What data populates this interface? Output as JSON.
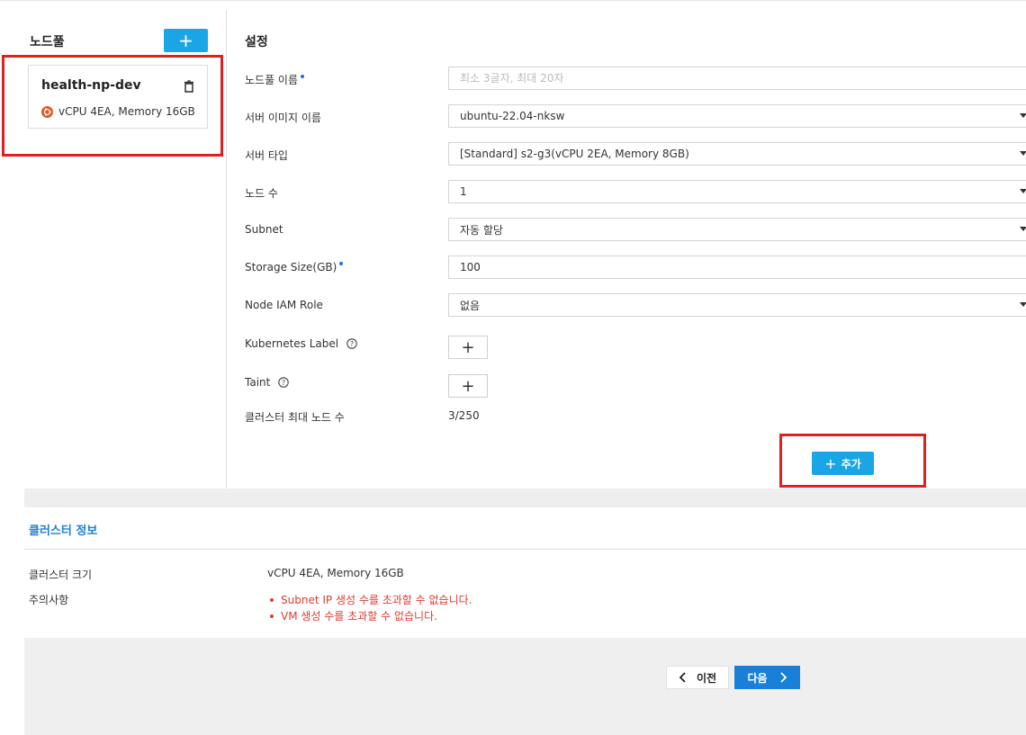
{
  "left": {
    "title": "노드풀",
    "add_button": "+",
    "pool": {
      "name": "health-np-dev",
      "spec": "vCPU 4EA, Memory 16GB"
    }
  },
  "settings": {
    "title": "설정",
    "rows": {
      "name": {
        "label": "노드풀 이름",
        "placeholder": "최소 3글자, 최대 20자"
      },
      "image": {
        "label": "서버 이미지 이름",
        "value": "ubuntu-22.04-nksw"
      },
      "type": {
        "label": "서버 타입",
        "value": "[Standard] s2-g3(vCPU 2EA, Memory 8GB)"
      },
      "count": {
        "label": "노드 수",
        "value": "1"
      },
      "subnet": {
        "label": "Subnet",
        "value": "자동 할당"
      },
      "storage": {
        "label": "Storage Size(GB)",
        "value": "100"
      },
      "iam": {
        "label": "Node IAM Role",
        "value": "없음"
      },
      "k8s_label": {
        "label": "Kubernetes Label",
        "button": "+"
      },
      "taint": {
        "label": "Taint",
        "button": "+"
      },
      "max_nodes": {
        "label": "클러스터 최대 노드 수",
        "value": "3/250"
      }
    },
    "add_button": {
      "plus": "+",
      "label": "추가"
    }
  },
  "cluster": {
    "title": "클러스터 정보",
    "size_label": "클러스터 크기",
    "size_value": "vCPU 4EA, Memory 16GB",
    "notes_label": "주의사항",
    "warnings": [
      "Subnet IP 생성 수를 초과할 수 없습니다.",
      "VM 생성 수를 초과할 수 없습니다."
    ]
  },
  "footer": {
    "prev": "이전",
    "next": "다음"
  },
  "colors": {
    "accent": "#1aa6e4",
    "primary": "#1a7fd6",
    "highlight": "#e02020",
    "warning": "#e03c31"
  },
  "icons": {
    "add": "plus-icon",
    "delete": "trash-icon",
    "os": "ubuntu-icon",
    "help": "help-circle-icon",
    "select": "caret-down-icon",
    "prev": "chevron-left-icon",
    "next": "chevron-right-icon"
  }
}
